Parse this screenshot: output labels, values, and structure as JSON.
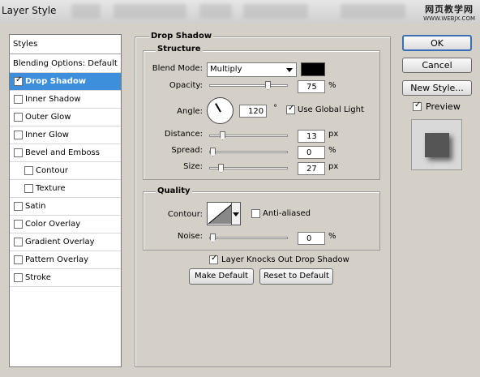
{
  "window": {
    "title": "Layer Style",
    "watermark_line1": "网页教学网",
    "watermark_line2": "WWW.WEBJX.COM"
  },
  "styles_list": {
    "header": "Styles",
    "items": [
      {
        "label": "Blending Options: Default",
        "checkbox": false,
        "checked": false,
        "selected": false,
        "indent": 0
      },
      {
        "label": "Drop Shadow",
        "checkbox": true,
        "checked": true,
        "selected": true,
        "indent": 0
      },
      {
        "label": "Inner Shadow",
        "checkbox": true,
        "checked": false,
        "selected": false,
        "indent": 0
      },
      {
        "label": "Outer Glow",
        "checkbox": true,
        "checked": false,
        "selected": false,
        "indent": 0
      },
      {
        "label": "Inner Glow",
        "checkbox": true,
        "checked": false,
        "selected": false,
        "indent": 0
      },
      {
        "label": "Bevel and Emboss",
        "checkbox": true,
        "checked": false,
        "selected": false,
        "indent": 0
      },
      {
        "label": "Contour",
        "checkbox": true,
        "checked": false,
        "selected": false,
        "indent": 1
      },
      {
        "label": "Texture",
        "checkbox": true,
        "checked": false,
        "selected": false,
        "indent": 1
      },
      {
        "label": "Satin",
        "checkbox": true,
        "checked": false,
        "selected": false,
        "indent": 0
      },
      {
        "label": "Color Overlay",
        "checkbox": true,
        "checked": false,
        "selected": false,
        "indent": 0
      },
      {
        "label": "Gradient Overlay",
        "checkbox": true,
        "checked": false,
        "selected": false,
        "indent": 0
      },
      {
        "label": "Pattern Overlay",
        "checkbox": true,
        "checked": false,
        "selected": false,
        "indent": 0
      },
      {
        "label": "Stroke",
        "checkbox": true,
        "checked": false,
        "selected": false,
        "indent": 0
      }
    ]
  },
  "drop_shadow": {
    "title": "Drop Shadow",
    "structure": {
      "title": "Structure",
      "blend_mode_label": "Blend Mode:",
      "blend_mode_value": "Multiply",
      "shadow_color": "#000000",
      "opacity_label": "Opacity:",
      "opacity_value": "75",
      "opacity_unit": "%",
      "opacity_fraction": 0.75,
      "angle_label": "Angle:",
      "angle_value": "120",
      "angle_unit": "°",
      "angle_degrees": 120,
      "use_global_light_label": "Use Global Light",
      "use_global_light_checked": true,
      "distance_label": "Distance:",
      "distance_value": "13",
      "distance_unit": "px",
      "distance_fraction": 0.13,
      "spread_label": "Spread:",
      "spread_value": "0",
      "spread_unit": "%",
      "spread_fraction": 0,
      "size_label": "Size:",
      "size_value": "27",
      "size_unit": "px",
      "size_fraction": 0.11
    },
    "quality": {
      "title": "Quality",
      "contour_label": "Contour:",
      "anti_aliased_label": "Anti-aliased",
      "anti_aliased_checked": false,
      "noise_label": "Noise:",
      "noise_value": "0",
      "noise_unit": "%",
      "noise_fraction": 0
    },
    "knocks_out_label": "Layer Knocks Out Drop Shadow",
    "knocks_out_checked": true,
    "make_default_label": "Make Default",
    "reset_default_label": "Reset to Default"
  },
  "buttons": {
    "ok": "OK",
    "cancel": "Cancel",
    "new_style": "New Style..."
  },
  "preview": {
    "label": "Preview",
    "checked": true
  }
}
